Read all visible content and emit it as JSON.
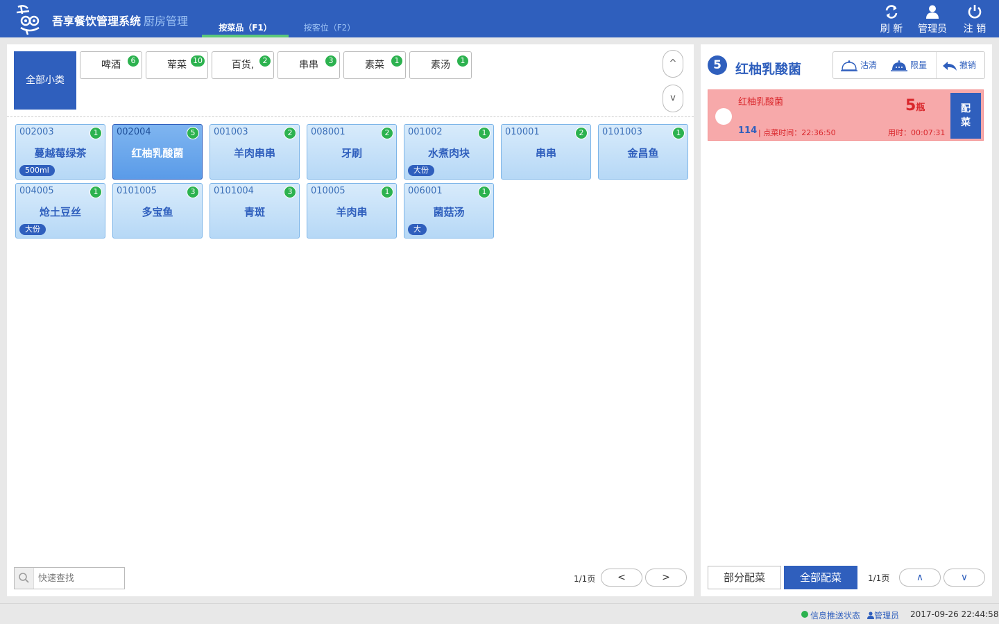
{
  "header": {
    "app_title": "吾享餐饮管理系统",
    "app_subtitle": "厨房管理",
    "tabs": [
      {
        "label": "按菜品（F1）"
      },
      {
        "label": "按客位（F2）"
      }
    ],
    "buttons": {
      "refresh": "刷 新",
      "admin": "管理员",
      "logout": "注 销"
    }
  },
  "categories": {
    "all_label": "全部小类",
    "items": [
      {
        "label": "啤酒",
        "count": "6"
      },
      {
        "label": "荤菜",
        "count": "10"
      },
      {
        "label": "百货,",
        "count": "2"
      },
      {
        "label": "串串",
        "count": "3"
      },
      {
        "label": "素菜",
        "count": "1"
      },
      {
        "label": "素汤",
        "count": "1"
      }
    ],
    "up": "^",
    "down": "v"
  },
  "dishes": [
    {
      "code": "002003",
      "name": "蔓越莓绿茶",
      "count": "1",
      "spec": "500ml"
    },
    {
      "code": "002004",
      "name": "红柚乳酸菌",
      "count": "5",
      "spec": ""
    },
    {
      "code": "001003",
      "name": "羊肉串串",
      "count": "2",
      "spec": ""
    },
    {
      "code": "008001",
      "name": "牙刷",
      "count": "2",
      "spec": ""
    },
    {
      "code": "001002",
      "name": "水煮肉块",
      "count": "1",
      "spec": "大份"
    },
    {
      "code": "010001",
      "name": "串串",
      "count": "2",
      "spec": ""
    },
    {
      "code": "0101003",
      "name": "金昌鱼",
      "count": "1",
      "spec": ""
    },
    {
      "code": "004005",
      "name": "炝土豆丝",
      "count": "1",
      "spec": "大份"
    },
    {
      "code": "0101005",
      "name": "多宝鱼",
      "count": "3",
      "spec": ""
    },
    {
      "code": "0101004",
      "name": "青斑",
      "count": "3",
      "spec": ""
    },
    {
      "code": "010005",
      "name": "羊肉串",
      "count": "1",
      "spec": ""
    },
    {
      "code": "006001",
      "name": "菌菇汤",
      "count": "1",
      "spec": "大"
    }
  ],
  "left_footer": {
    "search_placeholder": "快速查找",
    "page_info": "1/1页",
    "prev": "<",
    "next": ">"
  },
  "detail": {
    "count": "5",
    "title": "红柚乳酸菌",
    "actions": {
      "clear": "沽清",
      "limit": "限量",
      "undo": "撤销"
    },
    "order": {
      "name": "红柚乳酸菌",
      "qty": "5",
      "unit": "瓶",
      "table": "114",
      "order_time": "| 点菜时间：22:36:50",
      "elapsed": "用时：00:07:31",
      "assign_label": "配\n菜"
    },
    "footer": {
      "partial": "部分配菜",
      "all": "全部配菜",
      "page_info": "1/1页",
      "up": "∧",
      "down": "∨"
    }
  },
  "statusbar": {
    "push_status": "信息推送状态",
    "user": "管理员",
    "datetime": "2017-09-26 22:44:58"
  },
  "colors": {
    "primary": "#2f5fbd",
    "badge_green": "#2cb24f",
    "alert_red": "#d9252a",
    "card_pink": "#f7a9aa"
  }
}
